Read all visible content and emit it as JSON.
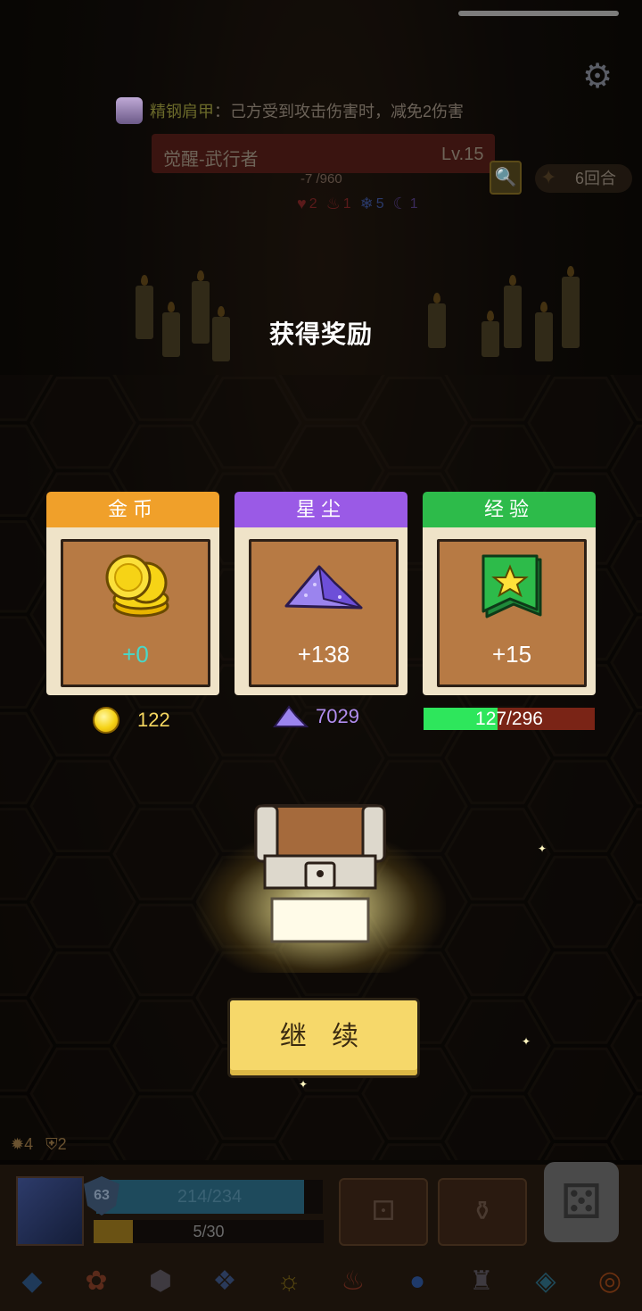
{
  "buff": {
    "name": "精钢肩甲",
    "desc": "：己方受到攻击伤害时，减免2伤害"
  },
  "enemy": {
    "name": "觉醒-武行者",
    "level": "Lv.15",
    "hp": "-7 /960",
    "stats": [
      {
        "icon": "heart-icon",
        "value": "2",
        "color": "#5a1a1a"
      },
      {
        "icon": "flame-icon",
        "value": "1",
        "color": "#5a1a1a"
      },
      {
        "icon": "snowflake-icon",
        "value": "5",
        "color": "#2a3a6a"
      },
      {
        "icon": "moon-icon",
        "value": "1",
        "color": "#3a2a5a"
      }
    ]
  },
  "turns": "6回合",
  "title": "获得奖励",
  "rewards": [
    {
      "label": "金币",
      "amount": "+0",
      "header_color": "#f0a02a",
      "amount_color": "#48d8c8"
    },
    {
      "label": "星尘",
      "amount": "+138",
      "header_color": "#9a5ae6",
      "amount_color": "#ffffff"
    },
    {
      "label": "经验",
      "amount": "+15",
      "header_color": "#2dbb4a",
      "amount_color": "#ffffff"
    }
  ],
  "totals": {
    "gold": "122",
    "stardust": "7029",
    "xp": "127/296",
    "xp_fraction": 0.43
  },
  "continue_label": "继 续",
  "player": {
    "attack": "4",
    "defense": "2",
    "shield": "63",
    "hp": "214/234",
    "energy": "5/30"
  }
}
